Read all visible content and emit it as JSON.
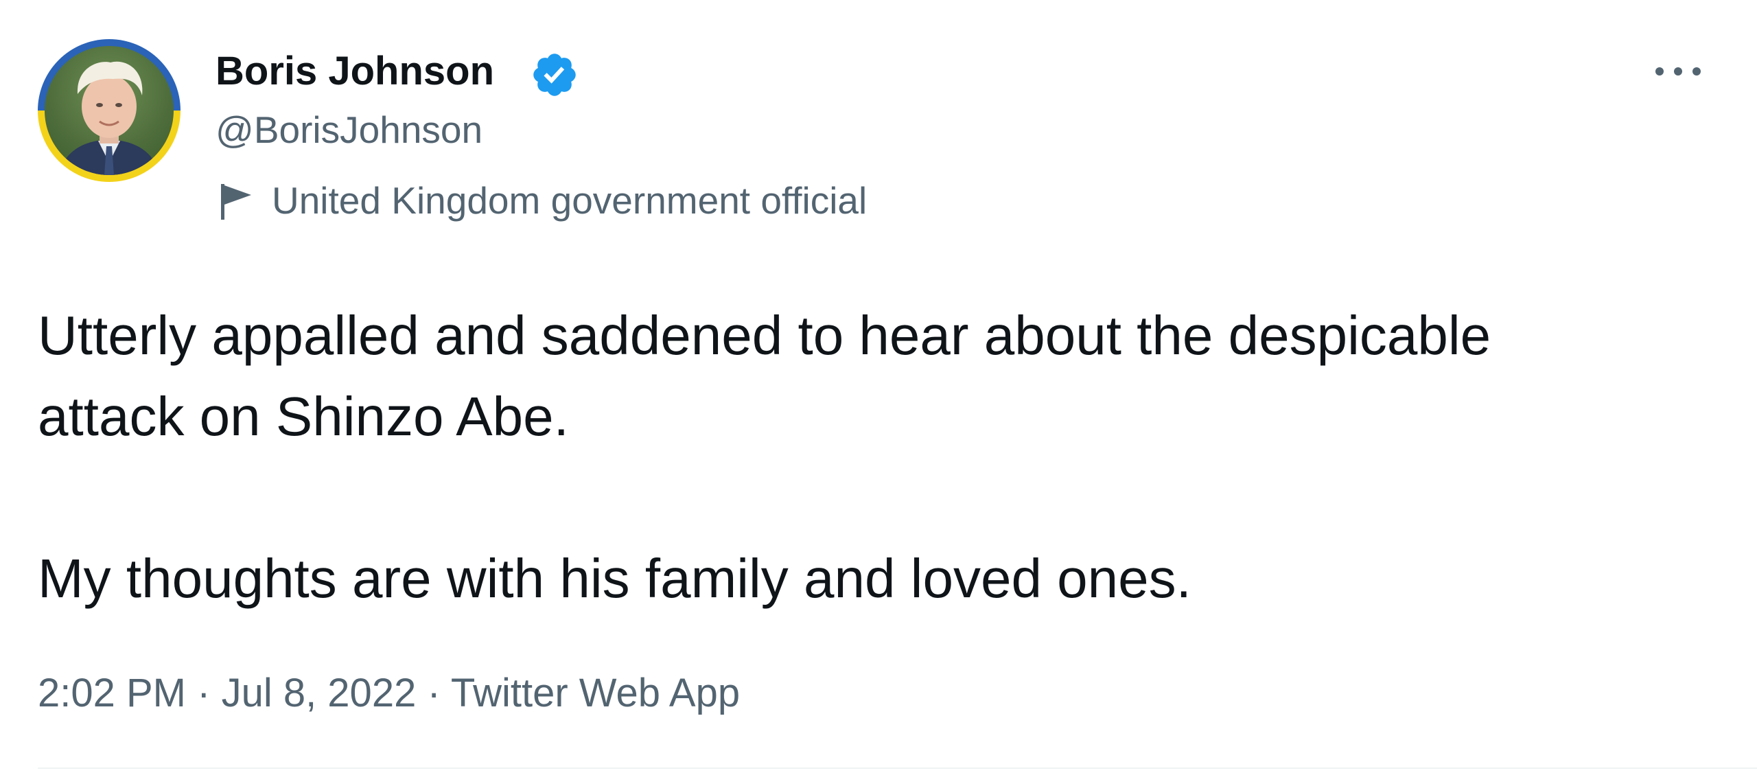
{
  "tweet": {
    "author": {
      "name": "Boris Johnson",
      "handle": "@BorisJohnson",
      "label": "United Kingdom government official",
      "verified": true,
      "avatar_ring_colors": [
        "#2a63b8",
        "#f3d21a"
      ]
    },
    "text": {
      "line1": "Utterly appalled and saddened to hear about the despicable attack on Shinzo Abe.",
      "line2": "My thoughts are with his family and loved ones."
    },
    "meta": {
      "time": "2:02 PM",
      "date": "Jul 8, 2022",
      "separator": "·",
      "source": "Twitter Web App"
    }
  },
  "icons": {
    "verified": "verified-badge-icon",
    "label": "flag-icon",
    "more": "more-options-icon"
  },
  "colors": {
    "text_primary": "#0f1419",
    "text_secondary": "#536471",
    "verified_blue": "#1d9bf0",
    "divider": "#eff3f4"
  }
}
